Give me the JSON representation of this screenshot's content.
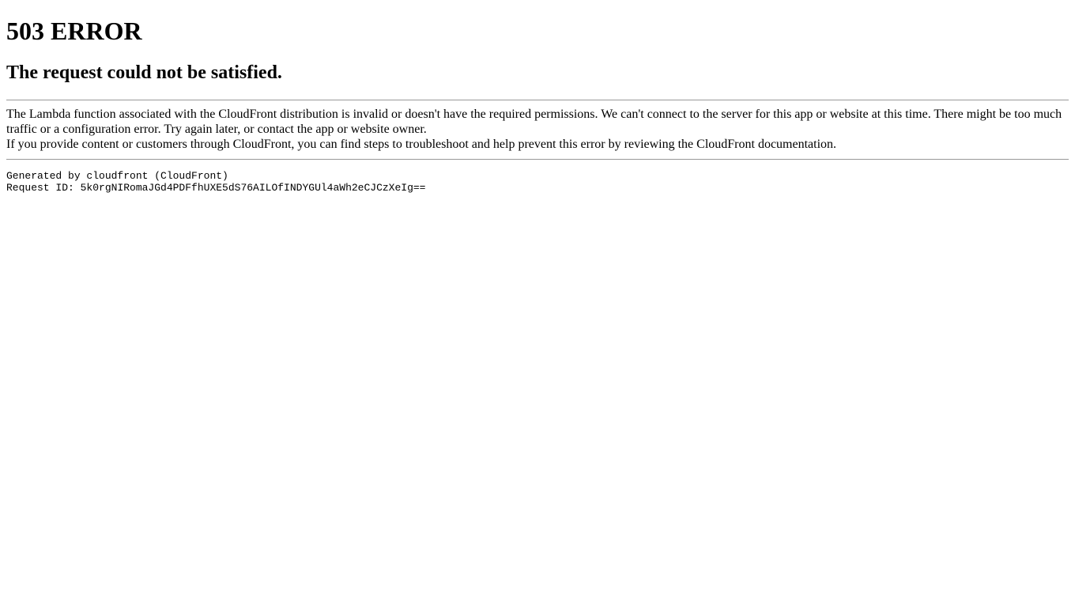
{
  "heading": "503 ERROR",
  "subheading": "The request could not be satisfied.",
  "message1": "The Lambda function associated with the CloudFront distribution is invalid or doesn't have the required permissions. We can't connect to the server for this app or website at this time. There might be too much traffic or a configuration error. Try again later, or contact the app or website owner.",
  "message2": "If you provide content or customers through CloudFront, you can find steps to troubleshoot and help prevent this error by reviewing the CloudFront documentation.",
  "generated": "Generated by cloudfront (CloudFront)\nRequest ID: 5k0rgNIRomaJGd4PDFfhUXE5dS76AILOfINDYGUl4aWh2eCJCzXeIg=="
}
